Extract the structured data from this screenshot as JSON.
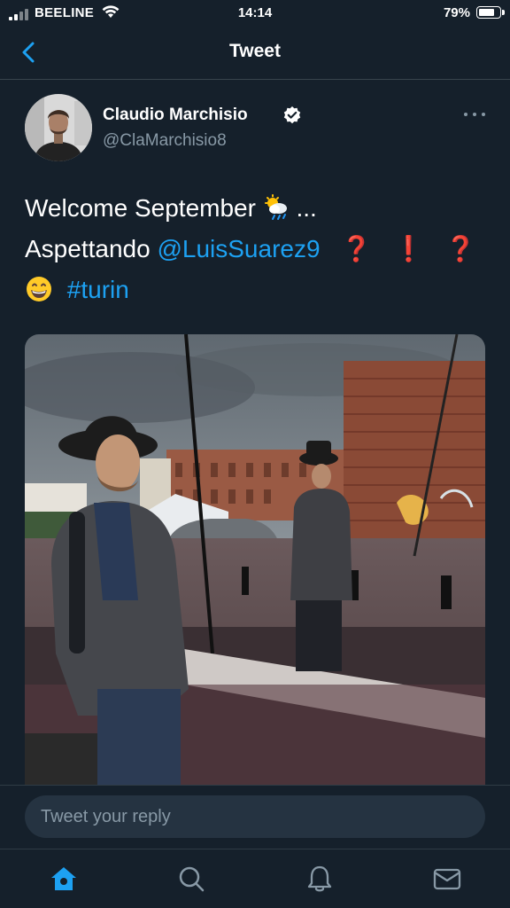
{
  "status_bar": {
    "carrier": "BEELINE",
    "time": "14:14",
    "battery": "79%",
    "battery_level": 0.79
  },
  "header": {
    "title": "Tweet",
    "back_icon": "chevron-left-icon"
  },
  "tweet": {
    "author_name": "Claudio Marchisio",
    "author_handle": "@ClaMarchisio8",
    "verified": true,
    "line1": "Welcome September",
    "line1_emoji": "sun-behind-rain-cloud-emoji",
    "line1_suffix": "...",
    "line2_prefix": "Aspettando",
    "mention": "@LuisSuarez9",
    "marks": [
      "❓",
      "❗",
      "❓"
    ],
    "line3_emoji": "grinning-face-emoji",
    "hashtag": "#turin",
    "media_description_icon": "photo"
  },
  "reply": {
    "placeholder": "Tweet your reply"
  },
  "bottom_nav": {
    "items": [
      "home-icon",
      "search-icon",
      "notifications-icon",
      "messages-icon"
    ],
    "active": "home-icon"
  },
  "colors": {
    "background": "#15202b",
    "accent": "#1da1f2",
    "secondary_text": "#8899a6",
    "divider": "#38444d"
  }
}
